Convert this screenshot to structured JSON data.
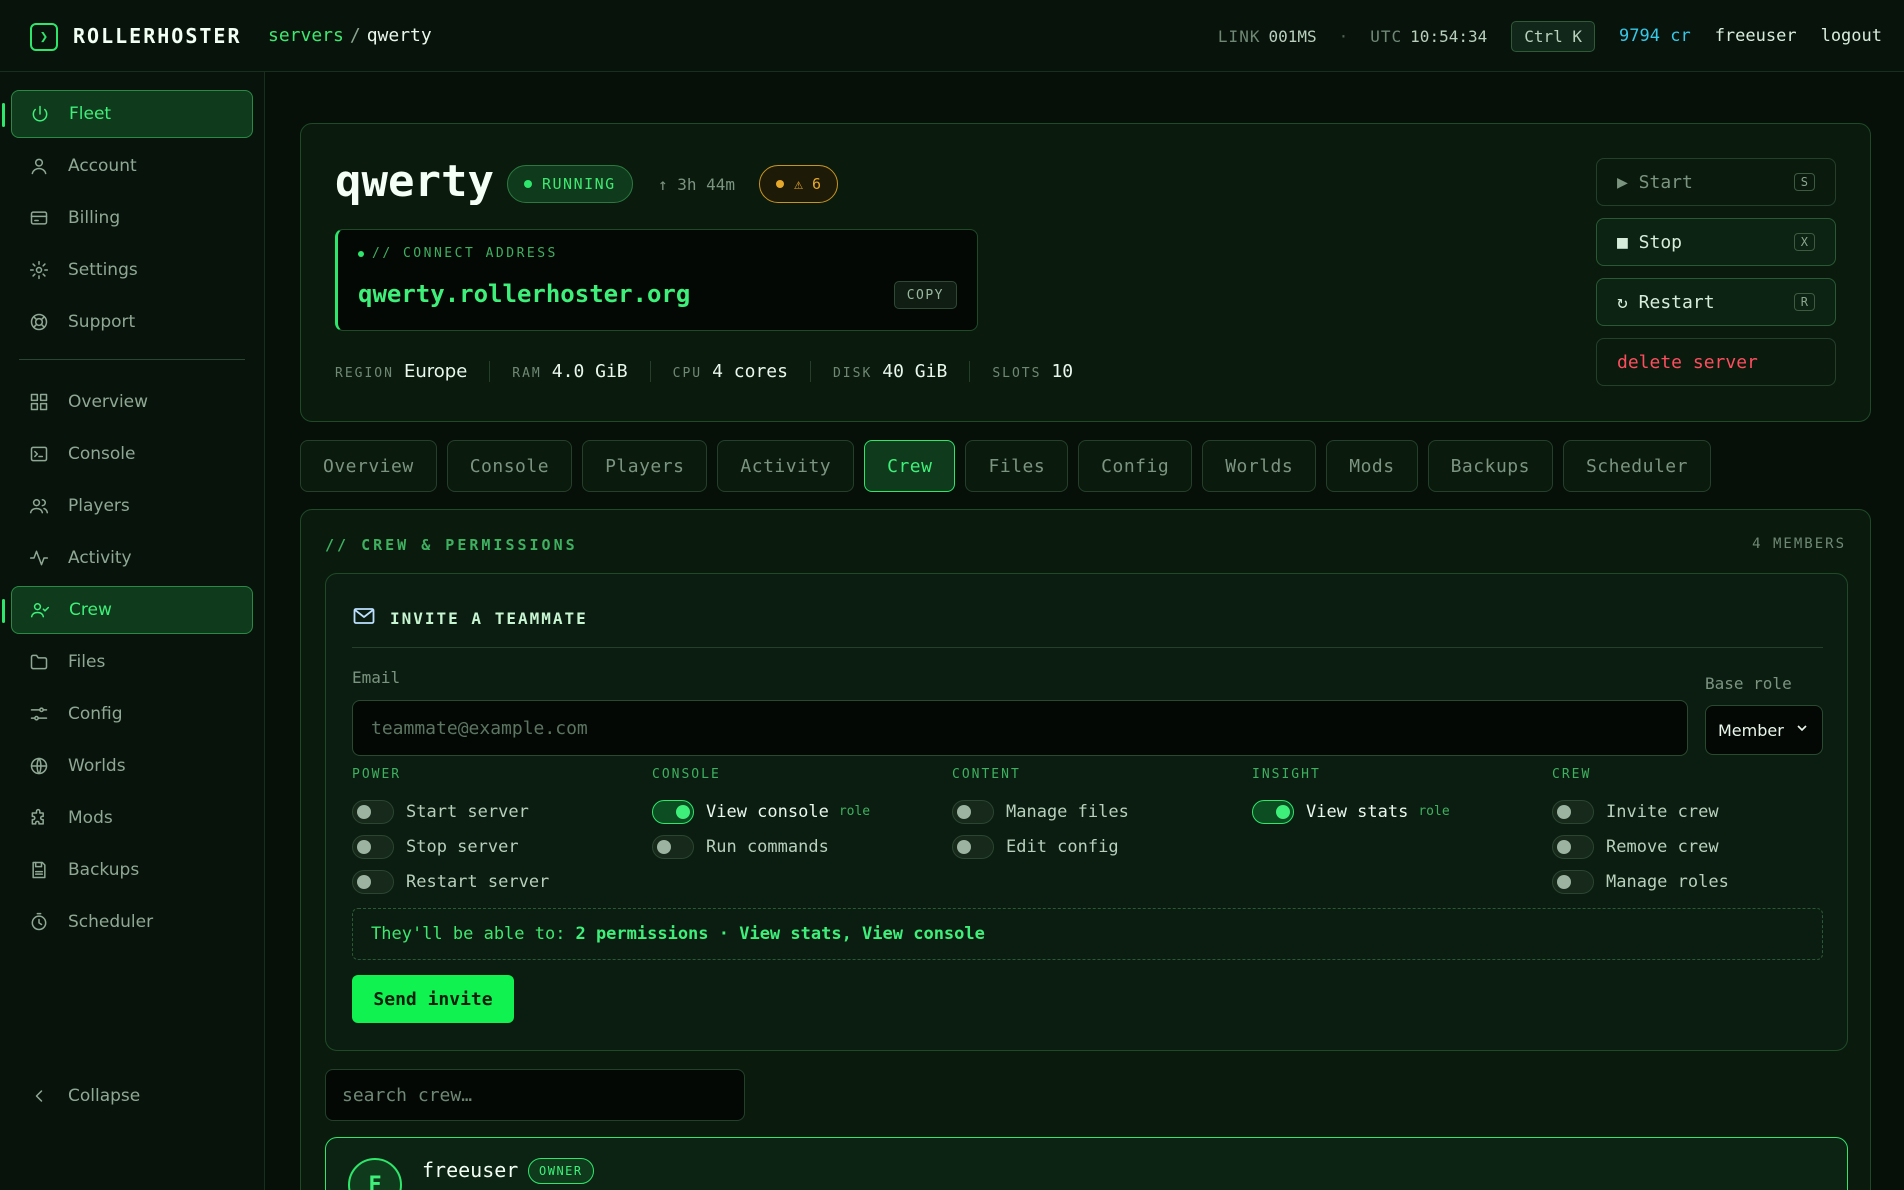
{
  "brand": "ROLLERHOSTER",
  "breadcrumb": {
    "root": "servers",
    "separator": "/",
    "current": "qwerty"
  },
  "topbar": {
    "link_label": "LINK",
    "link_value": "001MS",
    "dot": "·",
    "utc_label": "UTC",
    "utc_value": "10:54:34",
    "shortcut": "Ctrl K",
    "credits": "9794 cr",
    "username": "freeuser",
    "logout": "logout"
  },
  "sidebar": {
    "primary": [
      {
        "label": "Fleet",
        "icon": "power-icon"
      },
      {
        "label": "Account",
        "icon": "user-icon"
      },
      {
        "label": "Billing",
        "icon": "card-icon"
      },
      {
        "label": "Settings",
        "icon": "gear-icon"
      },
      {
        "label": "Support",
        "icon": "lifebuoy-icon"
      }
    ],
    "server": [
      {
        "label": "Overview",
        "icon": "grid-icon"
      },
      {
        "label": "Console",
        "icon": "terminal-icon"
      },
      {
        "label": "Players",
        "icon": "users-icon"
      },
      {
        "label": "Activity",
        "icon": "pulse-icon"
      },
      {
        "label": "Crew",
        "icon": "user-check-icon"
      },
      {
        "label": "Files",
        "icon": "folder-icon"
      },
      {
        "label": "Config",
        "icon": "sliders-icon"
      },
      {
        "label": "Worlds",
        "icon": "globe-icon"
      },
      {
        "label": "Mods",
        "icon": "puzzle-icon"
      },
      {
        "label": "Backups",
        "icon": "save-icon"
      },
      {
        "label": "Scheduler",
        "icon": "timer-icon"
      }
    ],
    "collapse": "Collapse"
  },
  "server": {
    "name": "qwerty",
    "status": "RUNNING",
    "uptime": "↑ 3h 44m",
    "warnings": "⚠ 6",
    "connect_label": "// CONNECT ADDRESS",
    "connect_address": "qwerty.rollerhoster.org",
    "copy": "COPY",
    "specs": [
      {
        "key": "REGION",
        "value": "Europe"
      },
      {
        "key": "RAM",
        "value": "4.0 GiB"
      },
      {
        "key": "CPU",
        "value": "4 cores"
      },
      {
        "key": "DISK",
        "value": "40 GiB"
      },
      {
        "key": "SLOTS",
        "value": "10"
      }
    ],
    "actions": {
      "start": "▶ Start",
      "start_key": "S",
      "stop": "■ Stop",
      "stop_key": "X",
      "restart": "↻ Restart",
      "restart_key": "R",
      "delete": "delete server"
    }
  },
  "tabs": [
    "Overview",
    "Console",
    "Players",
    "Activity",
    "Crew",
    "Files",
    "Config",
    "Worlds",
    "Mods",
    "Backups",
    "Scheduler"
  ],
  "crew": {
    "title": "// CREW & PERMISSIONS",
    "count": "4 MEMBERS",
    "invite": {
      "heading": "INVITE A TEAMMATE",
      "email_label": "Email",
      "email_placeholder": "teammate@example.com",
      "role_label": "Base role",
      "role_value": "Member",
      "groups": [
        {
          "name": "POWER",
          "perms": [
            {
              "label": "Start server",
              "on": false
            },
            {
              "label": "Stop server",
              "on": false
            },
            {
              "label": "Restart server",
              "on": false
            }
          ]
        },
        {
          "name": "CONSOLE",
          "perms": [
            {
              "label": "View console",
              "on": true,
              "tag": "role"
            },
            {
              "label": "Run commands",
              "on": false
            }
          ]
        },
        {
          "name": "CONTENT",
          "perms": [
            {
              "label": "Manage files",
              "on": false
            },
            {
              "label": "Edit config",
              "on": false
            }
          ]
        },
        {
          "name": "INSIGHT",
          "perms": [
            {
              "label": "View stats",
              "on": true,
              "tag": "role"
            }
          ]
        },
        {
          "name": "CREW",
          "perms": [
            {
              "label": "Invite crew",
              "on": false
            },
            {
              "label": "Remove crew",
              "on": false
            },
            {
              "label": "Manage roles",
              "on": false
            }
          ]
        }
      ],
      "summary_prefix": "They'll be able to:",
      "summary_value": "2 permissions · View stats, View console",
      "send": "Send invite"
    },
    "search_placeholder": "search crew…",
    "members": [
      {
        "initial": "F",
        "name": "freeuser",
        "role": "OWNER"
      }
    ]
  }
}
